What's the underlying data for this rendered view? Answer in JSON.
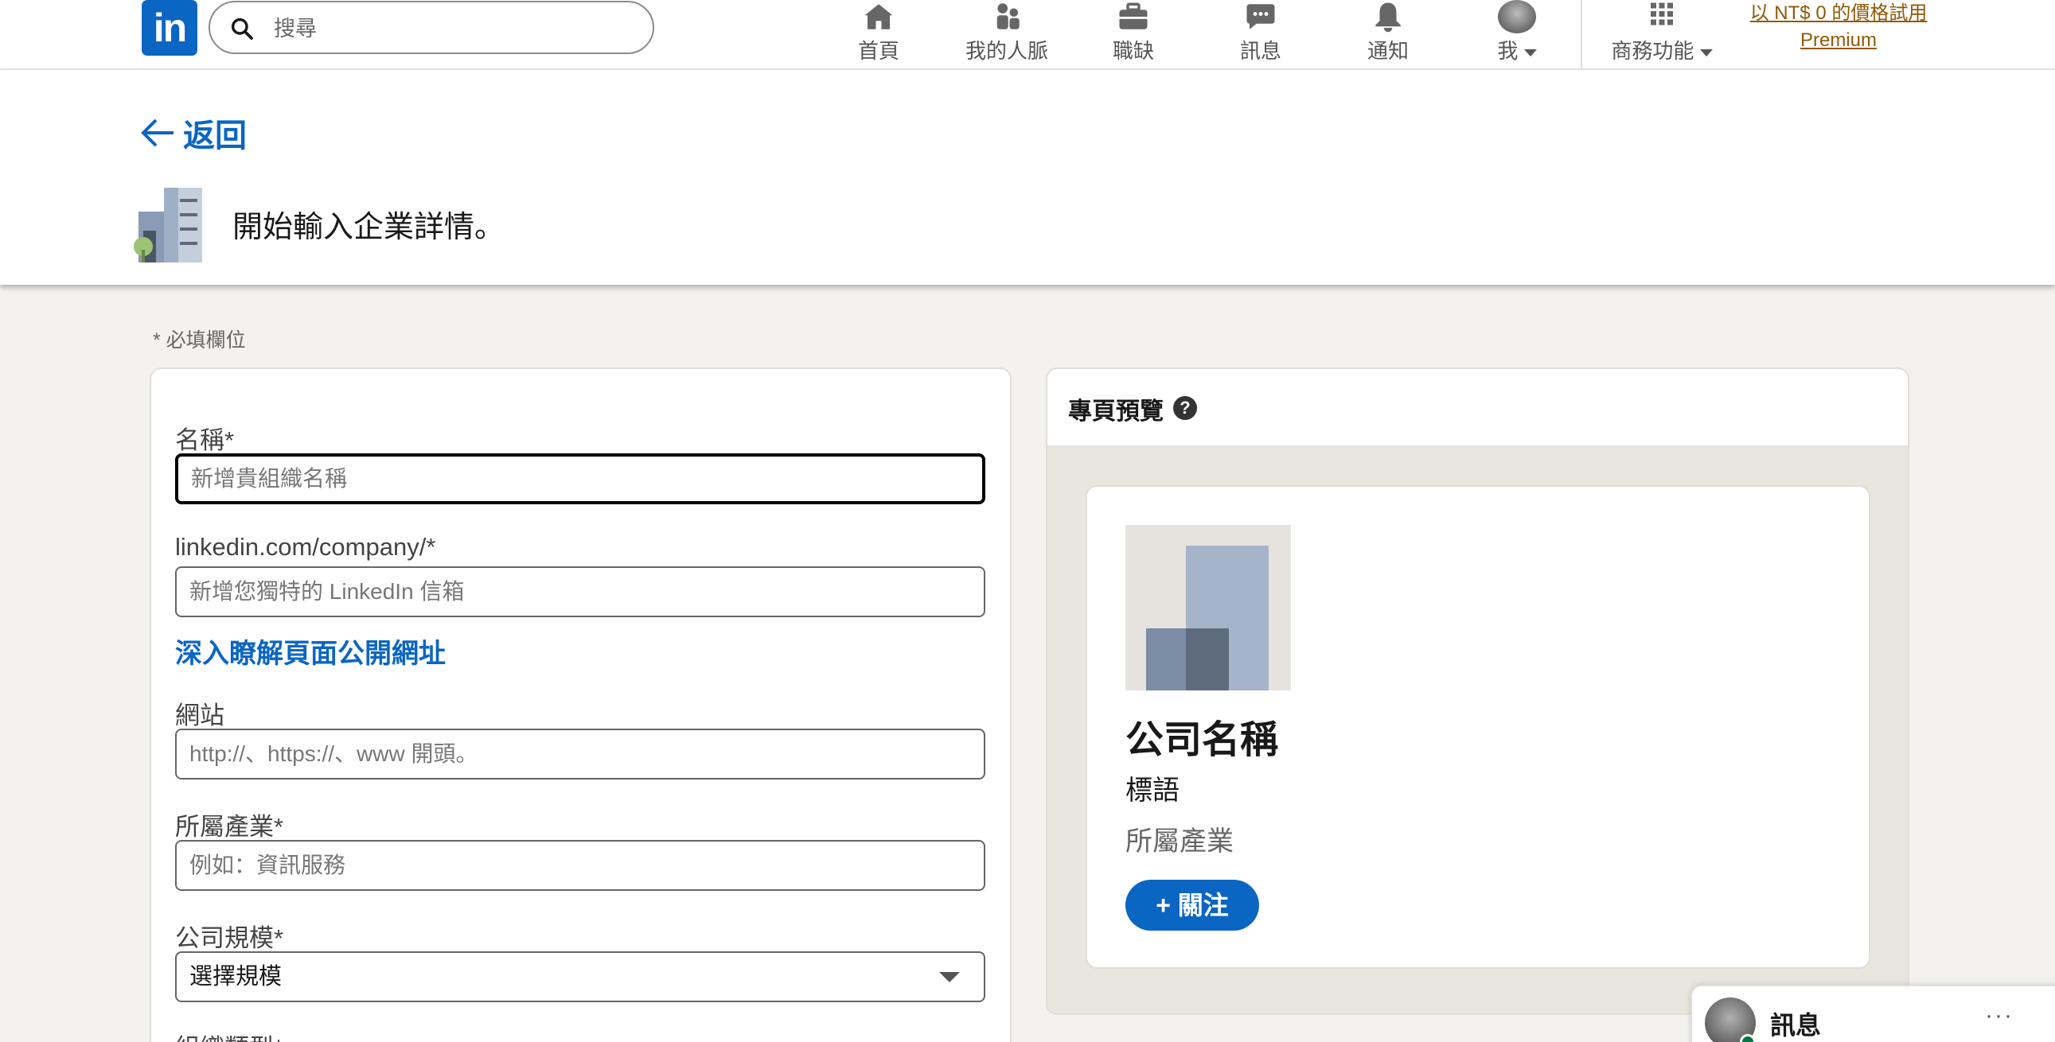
{
  "nav": {
    "logo_text": "in",
    "search_placeholder": "搜尋",
    "items": [
      {
        "label": "首頁",
        "icon": "home-icon"
      },
      {
        "label": "我的人脈",
        "icon": "people-icon"
      },
      {
        "label": "職缺",
        "icon": "briefcase-icon"
      },
      {
        "label": "訊息",
        "icon": "chat-icon"
      },
      {
        "label": "通知",
        "icon": "bell-icon"
      },
      {
        "label": "我",
        "icon": "avatar"
      },
      {
        "label": "商務功能",
        "icon": "grid-icon"
      }
    ],
    "premium_line1": "以 NT$ 0 的價格試用",
    "premium_line2": "Premium"
  },
  "header": {
    "back_label": "返回",
    "title": "開始輸入企業詳情。"
  },
  "form": {
    "required_note": "*  必填欄位",
    "name": {
      "label": "名稱*",
      "placeholder": "新增貴組織名稱"
    },
    "url": {
      "label": "linkedin.com/company/*",
      "placeholder": "新增您獨特的 LinkedIn 信箱"
    },
    "learn_more": "深入瞭解頁面公開網址",
    "website": {
      "label": "網站",
      "placeholder": "http://、https://、www 開頭。"
    },
    "industry": {
      "label": "所屬產業*",
      "placeholder": "例如：資訊服務"
    },
    "size": {
      "label": "公司規模*",
      "value": "選擇規模"
    },
    "org_type": {
      "label": "組織類型*"
    }
  },
  "preview": {
    "title": "專頁預覽",
    "company_name": "公司名稱",
    "tagline": "標語",
    "industry": "所屬產業",
    "follow_label": "+ 關注"
  },
  "messaging": {
    "label": "訊息",
    "more": "···"
  },
  "colors": {
    "brand": "#0a66c2",
    "premium": "#915907",
    "background": "#f3f2ef"
  }
}
